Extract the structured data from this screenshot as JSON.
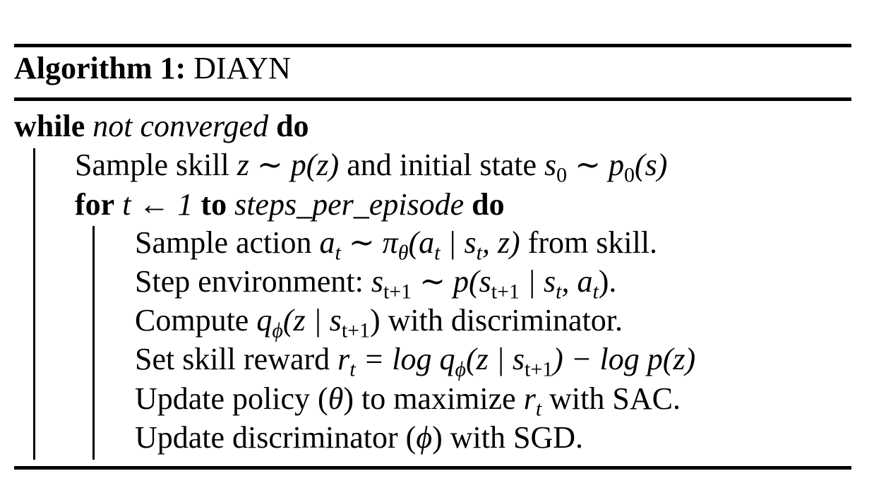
{
  "algorithm": {
    "label": "Algorithm 1:",
    "name": "DIAYN"
  },
  "lines": {
    "while_kw": "while",
    "while_cond": "not converged",
    "while_do": "do",
    "sample_skill": {
      "pre": "Sample skill ",
      "z": "z",
      "sim1": " ∼ ",
      "pz": "p(z)",
      "mid": " and initial state ",
      "s": "s",
      "s_sub": "0",
      "sim2": " ∼ ",
      "p": "p",
      "p_sub": "0",
      "ps": "(s)"
    },
    "for_kw": "for",
    "for_var": " t ← 1 ",
    "for_to": "to",
    "for_range": " steps_per_episode ",
    "for_do": "do",
    "sample_action": {
      "pre": "Sample action ",
      "a": "a",
      "a_sub": "t",
      "sim": " ∼ π",
      "pi_sub": "θ",
      "args1": "(a",
      "args1_sub": "t",
      "args2": " | s",
      "args2_sub": "t",
      "args3": ", z)",
      "post": " from skill."
    },
    "step_env": {
      "pre": "Step environment: ",
      "s1": "s",
      "s1_sub": "t+1",
      "mid": " ∼ p(s",
      "s2_sub": "t+1",
      "bar": " | s",
      "s3_sub": "t",
      "comma": ", a",
      "a_sub": "t",
      "post": ")."
    },
    "compute": {
      "pre": "Compute ",
      "q": "q",
      "q_sub": "ϕ",
      "args": "(z | s",
      "s_sub": "t+1",
      "close": ")",
      "post": " with discriminator."
    },
    "reward": {
      "pre": "Set skill reward ",
      "r": "r",
      "r_sub": "t",
      "eq": " = log q",
      "q_sub": "ϕ",
      "args": "(z | s",
      "s_sub": "t+1",
      "tail": ") − log p(z)"
    },
    "update_policy": {
      "pre": "Update policy (",
      "theta": "θ",
      "mid": ") to maximize ",
      "r": "r",
      "r_sub": "t",
      "post": " with SAC."
    },
    "update_disc": {
      "pre": "Update discriminator (",
      "phi": "ϕ",
      "post": ") with SGD."
    }
  }
}
